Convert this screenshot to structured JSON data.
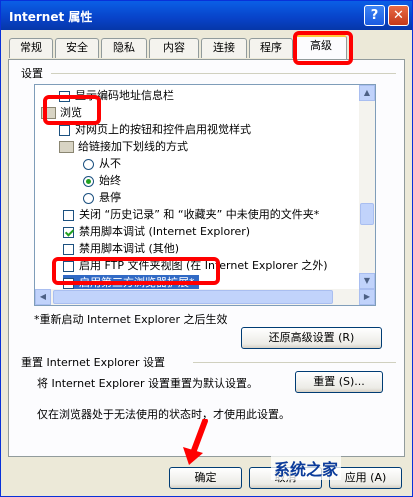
{
  "window": {
    "title": "Internet 属性",
    "help": "?",
    "close": "✕"
  },
  "tabs": [
    {
      "label": "常规"
    },
    {
      "label": "安全"
    },
    {
      "label": "隐私"
    },
    {
      "label": "内容"
    },
    {
      "label": "连接"
    },
    {
      "label": "程序"
    },
    {
      "label": "高级"
    }
  ],
  "settings_label": "设置",
  "list": {
    "items": [
      {
        "type": "checkbox",
        "checked": false,
        "label": "显示编码地址信息栏"
      },
      {
        "type": "folder",
        "label": "浏览"
      },
      {
        "type": "checkbox",
        "checked": false,
        "label": "对网页上的按钮和控件启用视觉样式"
      },
      {
        "type": "folder",
        "label": "给链接加下划线的方式"
      },
      {
        "type": "radio",
        "checked": false,
        "label": "从不"
      },
      {
        "type": "radio",
        "checked": true,
        "label": "始终"
      },
      {
        "type": "radio",
        "checked": false,
        "label": "悬停"
      },
      {
        "type": "checkbox",
        "checked": false,
        "label": "关闭 “历史记录” 和 “收藏夹” 中未使用的文件夹*"
      },
      {
        "type": "checkbox",
        "checked": true,
        "label": "禁用脚本调试 (Internet Explorer)"
      },
      {
        "type": "checkbox",
        "checked": false,
        "label": "禁用脚本调试 (其他)"
      },
      {
        "type": "checkbox",
        "checked": false,
        "label": "启用 FTP 文件夹视图 (在 Internet Explorer 之外)"
      },
      {
        "type": "checkbox",
        "checked": false,
        "label": "启用第三方浏览器扩展*"
      }
    ]
  },
  "note": "*重新启动 Internet Explorer 之后生效",
  "restore_button": "还原高级设置 (R)",
  "reset_section": {
    "title": "重置 Internet Explorer 设置",
    "desc": "将 Internet Explorer 设置重置为默认设置。",
    "button": "重置 (S)...",
    "hint": "仅在浏览器处于无法使用的状态时，才使用此设置。"
  },
  "footer": {
    "ok": "确定",
    "cancel": "取消",
    "apply": "应用 (A)"
  },
  "watermark": "系统之家",
  "colors": {
    "highlight": "#ff0000",
    "titlebar": "#0842c8",
    "selection": "#316ac5"
  }
}
